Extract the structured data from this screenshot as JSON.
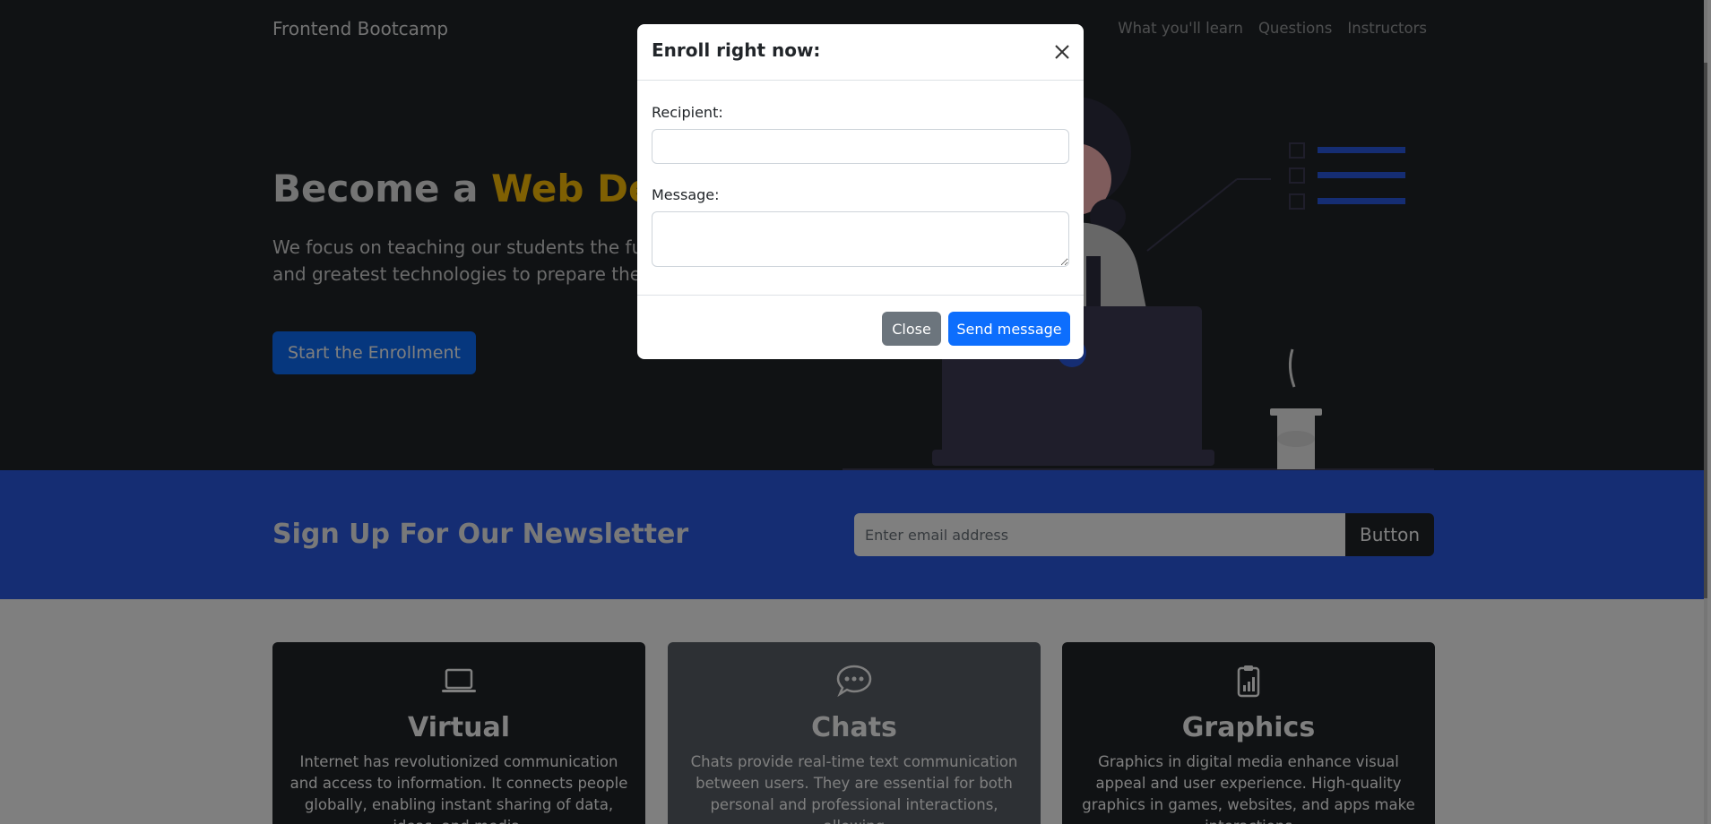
{
  "navbar": {
    "brand": "Frontend Bootcamp",
    "links": [
      "What you'll learn",
      "Questions",
      "Instructors"
    ]
  },
  "hero": {
    "title_prefix": "Become a ",
    "title_accent": "Web Developer",
    "text": "We focus on teaching our students the fundamentals of the latest and greatest technologies to prepare them for their first dev role",
    "button": "Start the Enrollment"
  },
  "newsletter": {
    "title": "Sign Up For Our Newsletter",
    "input_placeholder": "Enter email address",
    "button": "Button"
  },
  "cards": [
    {
      "icon": "laptop-icon",
      "title": "Virtual",
      "text": "Internet has revolutionized communication and access to information. It connects people globally, enabling instant sharing of data, ideas, and media."
    },
    {
      "icon": "chat-dots-icon",
      "title": "Chats",
      "text": "Chats provide real-time text communication between users. They are essential for both personal and professional interactions, allowing"
    },
    {
      "icon": "clipboard-data-icon",
      "title": "Graphics",
      "text": "Graphics in digital media enhance visual appeal and user experience. High-quality graphics in games, websites, and apps make interactions"
    }
  ],
  "modal": {
    "title": "Enroll right now:",
    "recipient_label": "Recipient:",
    "recipient_value": "",
    "message_label": "Message:",
    "message_value": "",
    "close_button": "Close",
    "send_button": "Send message"
  },
  "colors": {
    "hero_bg": "#212529",
    "accent": "#ffc107",
    "primary": "#0d6efd",
    "newsletter_bg": "#2b5ae6",
    "secondary": "#6c757d"
  }
}
